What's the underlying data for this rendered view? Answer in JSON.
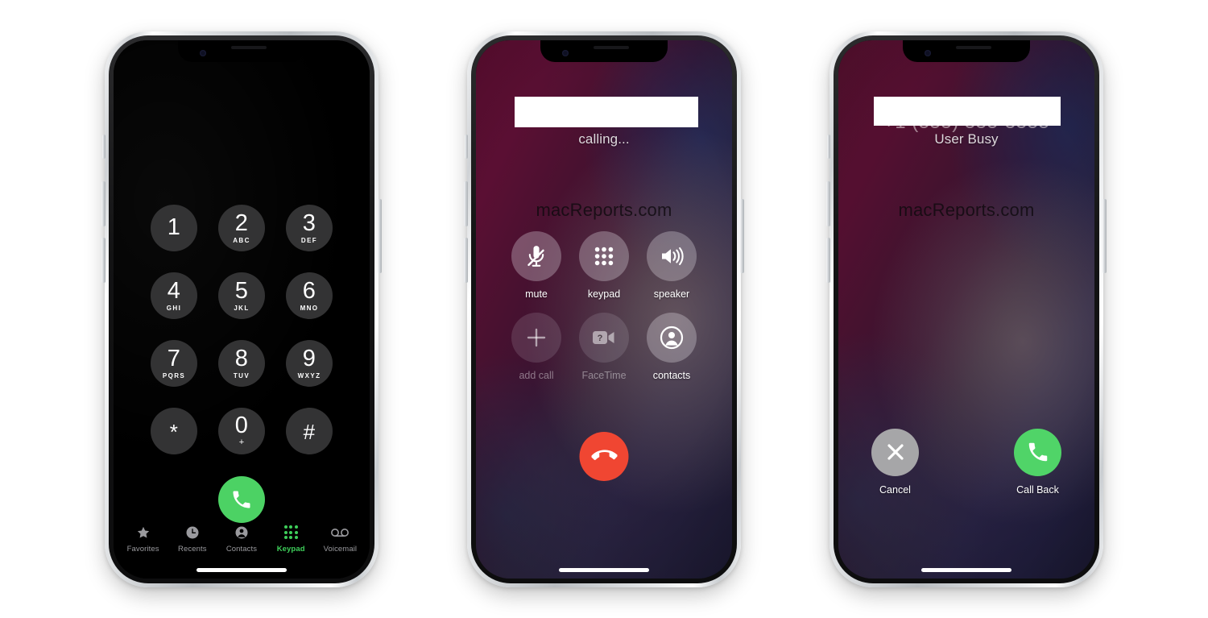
{
  "phones": [
    {
      "id": "keypad-phone",
      "screen": "keypad",
      "keys": [
        {
          "digit": "1",
          "letters": ""
        },
        {
          "digit": "2",
          "letters": "ABC"
        },
        {
          "digit": "3",
          "letters": "DEF"
        },
        {
          "digit": "4",
          "letters": "GHI"
        },
        {
          "digit": "5",
          "letters": "JKL"
        },
        {
          "digit": "6",
          "letters": "MNO"
        },
        {
          "digit": "7",
          "letters": "PQRS"
        },
        {
          "digit": "8",
          "letters": "TUV"
        },
        {
          "digit": "9",
          "letters": "WXYZ"
        },
        {
          "digit": "*",
          "letters": ""
        },
        {
          "digit": "0",
          "letters": "+"
        },
        {
          "digit": "#",
          "letters": ""
        }
      ],
      "call_button": {
        "name": "call-button",
        "icon": "phone-icon"
      },
      "tabbar": [
        {
          "label": "Favorites",
          "icon": "star-icon",
          "active": false
        },
        {
          "label": "Recents",
          "icon": "clock-icon",
          "active": false
        },
        {
          "label": "Contacts",
          "icon": "person-icon",
          "active": false
        },
        {
          "label": "Keypad",
          "icon": "keypad-dots-icon",
          "active": true
        },
        {
          "label": "Voicemail",
          "icon": "voicemail-icon",
          "active": false
        }
      ]
    },
    {
      "id": "calling-phone",
      "screen": "in-call",
      "contact_name_redacted": "",
      "status": "calling...",
      "watermark": "macReports.com",
      "controls": [
        {
          "label": "mute",
          "icon": "mute-microphone-icon",
          "disabled": false
        },
        {
          "label": "keypad",
          "icon": "keypad-dots-icon",
          "disabled": false
        },
        {
          "label": "speaker",
          "icon": "speaker-icon",
          "disabled": false
        },
        {
          "label": "add call",
          "icon": "plus-icon",
          "disabled": true
        },
        {
          "label": "FaceTime",
          "icon": "facetime-video-icon",
          "disabled": true
        },
        {
          "label": "contacts",
          "icon": "contacts-person-icon",
          "disabled": false
        }
      ],
      "end_button": {
        "name": "end-call-button",
        "icon": "end-call-icon"
      }
    },
    {
      "id": "user-busy-phone",
      "screen": "call-failed",
      "contact_name_redacted": "",
      "ghost_number": "+1 (555) 555-5555",
      "status": "User Busy",
      "watermark": "macReports.com",
      "actions": [
        {
          "label": "Cancel",
          "icon": "close-x-icon",
          "style": "gray"
        },
        {
          "label": "Call Back",
          "icon": "phone-icon",
          "style": "green"
        }
      ]
    }
  ],
  "colors": {
    "accent_green": "#4cd264",
    "end_red": "#f04632",
    "cancel_gray": "#a6a6a8",
    "keypad_key": "#333334",
    "active_tab": "#3ecf5a",
    "inactive_tab": "#9a9a9e",
    "page_background": "#ffffff"
  }
}
